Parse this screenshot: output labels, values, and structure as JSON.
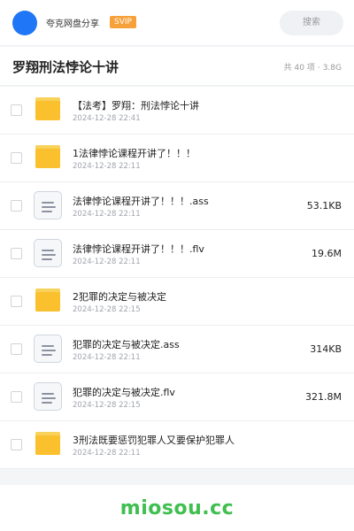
{
  "header": {
    "share_name": "夸克网盘分享",
    "badge": "SVIP",
    "search_label": "搜索",
    "avatar_color": "#1f76f7"
  },
  "titlebar": {
    "title": "罗翔刑法悖论十讲",
    "count": "共 40 项",
    "size": "3.8G"
  },
  "files": [
    {
      "type": "folder",
      "name": "【法考】罗翔：刑法悖论十讲",
      "date": "2024-12-28 22:41",
      "size": ""
    },
    {
      "type": "folder",
      "name": "1法律悖论课程开讲了！！！",
      "date": "2024-12-28 22:11",
      "size": ""
    },
    {
      "type": "doc",
      "name": "法律悖论课程开讲了！！！.ass",
      "date": "2024-12-28 22:11",
      "size": "53.1KB"
    },
    {
      "type": "doc",
      "name": "法律悖论课程开讲了！！！.flv",
      "date": "2024-12-28 22:11",
      "size": "19.6M"
    },
    {
      "type": "folder",
      "name": "2犯罪的决定与被决定",
      "date": "2024-12-28 22:15",
      "size": ""
    },
    {
      "type": "doc",
      "name": "犯罪的决定与被决定.ass",
      "date": "2024-12-28 22:11",
      "size": "314KB"
    },
    {
      "type": "doc",
      "name": "犯罪的决定与被决定.flv",
      "date": "2024-12-28 22:15",
      "size": "321.8M"
    },
    {
      "type": "folder",
      "name": "3刑法既要惩罚犯罪人又要保护犯罪人",
      "date": "2024-12-28 22:11",
      "size": ""
    }
  ],
  "footer": {
    "watermark": "miosou.cc",
    "watermark_color": "#3fbf4f"
  }
}
